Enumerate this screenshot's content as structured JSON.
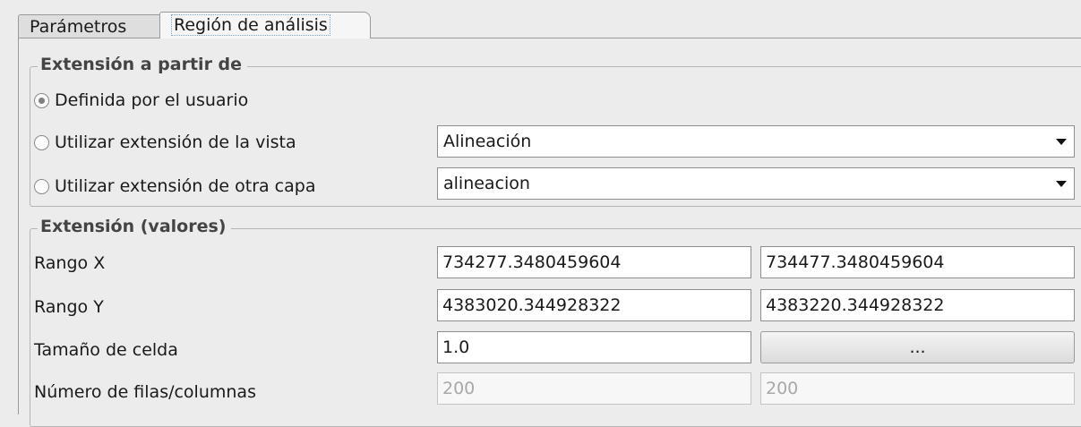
{
  "tabs": [
    {
      "label": "Parámetros"
    },
    {
      "label": "Región de análisis"
    }
  ],
  "extent_source": {
    "legend": "Extensión a partir de",
    "options": [
      {
        "label": "Definida por el usuario",
        "selected": true
      },
      {
        "label": "Utilizar extensión de la vista",
        "selected": false,
        "combo_value": "Alineación"
      },
      {
        "label": "Utilizar extensión de otra capa",
        "selected": false,
        "combo_value": "alineacion"
      }
    ]
  },
  "extent_values": {
    "legend": "Extensión (valores)",
    "range_x": {
      "label": "Rango X",
      "min": "734277.3480459604",
      "max": "734477.3480459604"
    },
    "range_y": {
      "label": "Rango Y",
      "min": "4383020.344928322",
      "max": "4383220.344928322"
    },
    "cell_size": {
      "label": "Tamaño de celda",
      "value": "1.0",
      "button_label": "..."
    },
    "rows_cols": {
      "label": "Número de filas/columnas",
      "rows": "200",
      "cols": "200"
    }
  }
}
